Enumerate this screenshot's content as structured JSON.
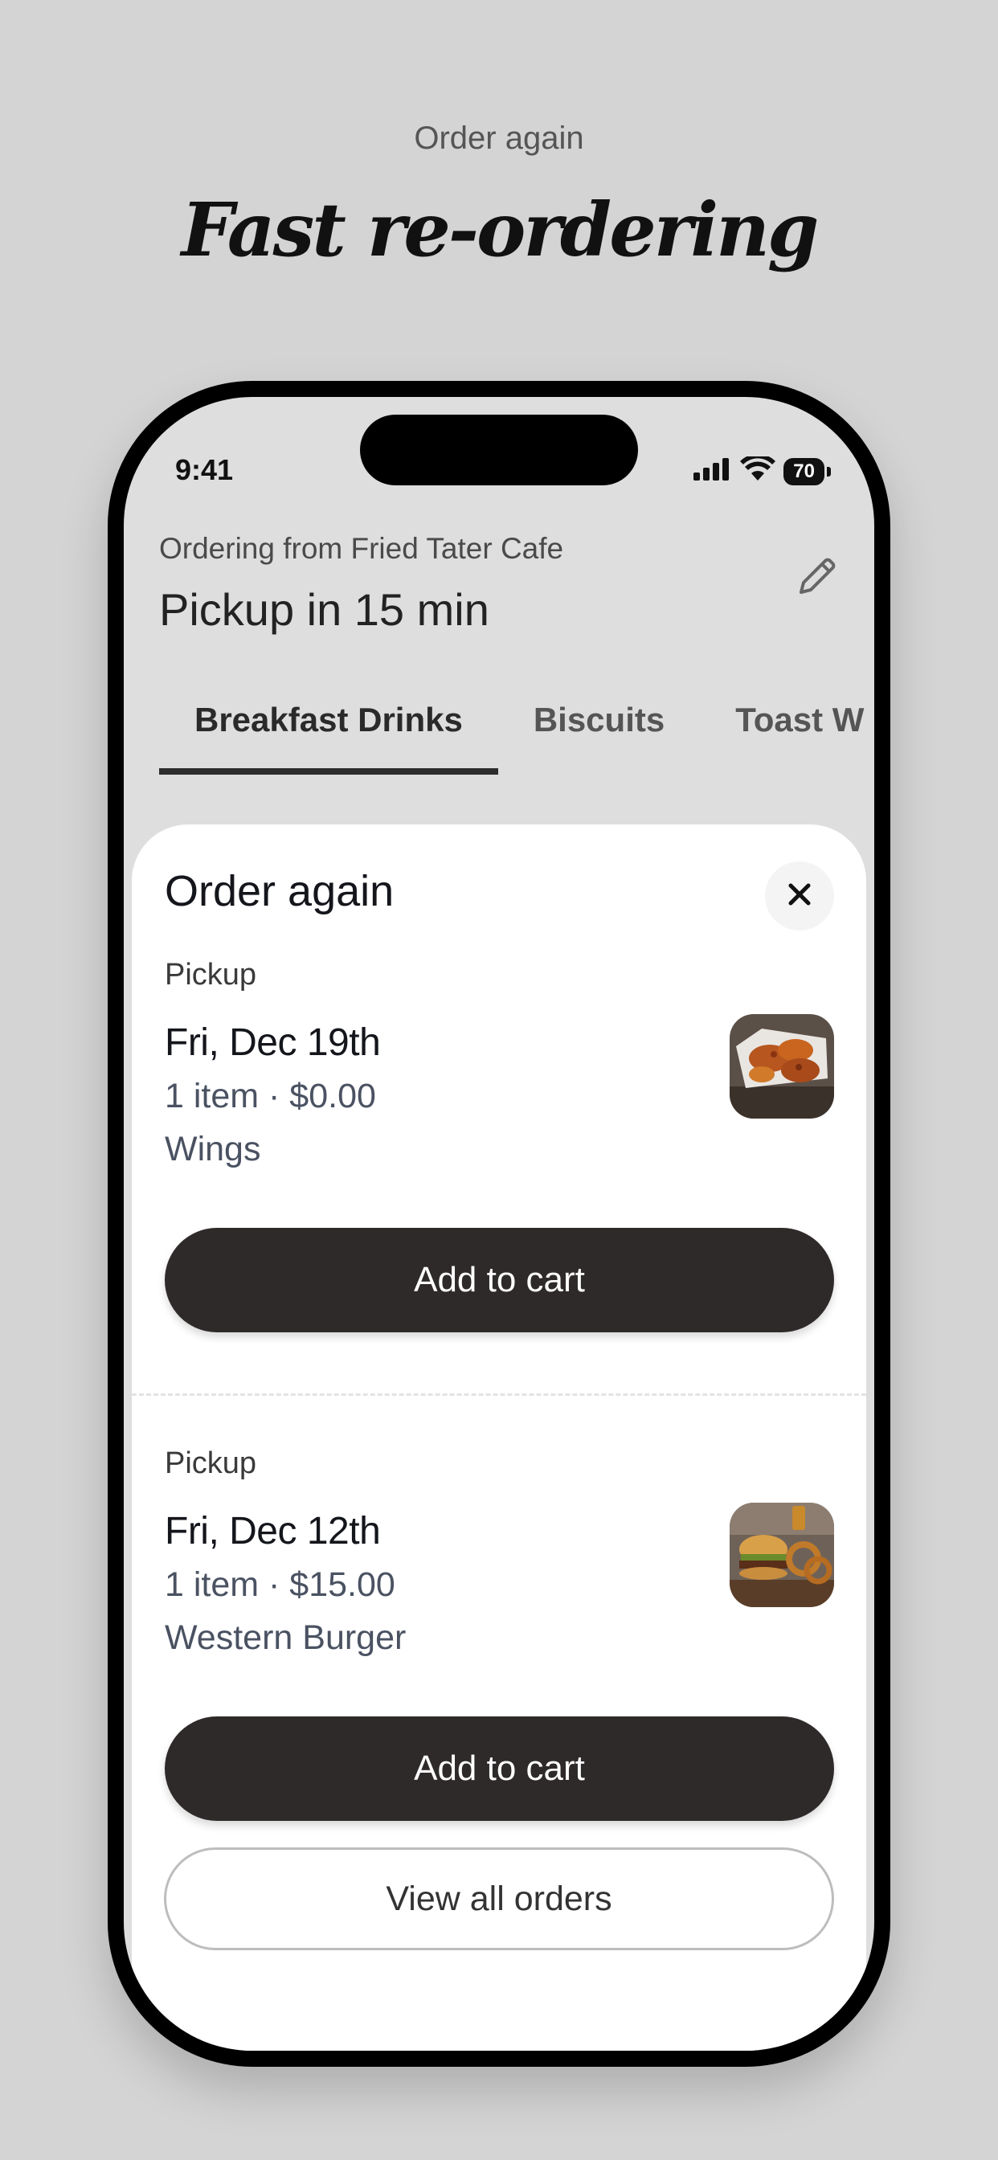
{
  "promo": {
    "eyebrow": "Order again",
    "title": "Fast re-ordering"
  },
  "status_bar": {
    "time": "9:41",
    "battery": "70"
  },
  "header": {
    "ordering_from": "Ordering from Fried Tater Cafe",
    "pickup_eta": "Pickup in 15 min",
    "edit_icon": "pencil-icon"
  },
  "tabs": [
    {
      "label": "Breakfast Drinks",
      "active": true
    },
    {
      "label": "Biscuits",
      "active": false
    },
    {
      "label": "Toast W",
      "active": false
    }
  ],
  "sheet": {
    "title": "Order again",
    "close_icon": "close-icon",
    "orders": [
      {
        "type": "Pickup",
        "date": "Fri, Dec 19th",
        "meta": "1 item · $0.00",
        "items": "Wings",
        "thumb": "wings-photo",
        "button": "Add to cart"
      },
      {
        "type": "Pickup",
        "date": "Fri, Dec 12th",
        "meta": "1 item · $15.00",
        "items": "Western Burger",
        "thumb": "burger-photo",
        "button": "Add to cart"
      }
    ],
    "view_all": "View all orders"
  },
  "colors": {
    "background": "#d4d4d4",
    "primary_button": "#2f2a2a",
    "text_dark": "#14161c",
    "text_muted": "#4a5262"
  }
}
